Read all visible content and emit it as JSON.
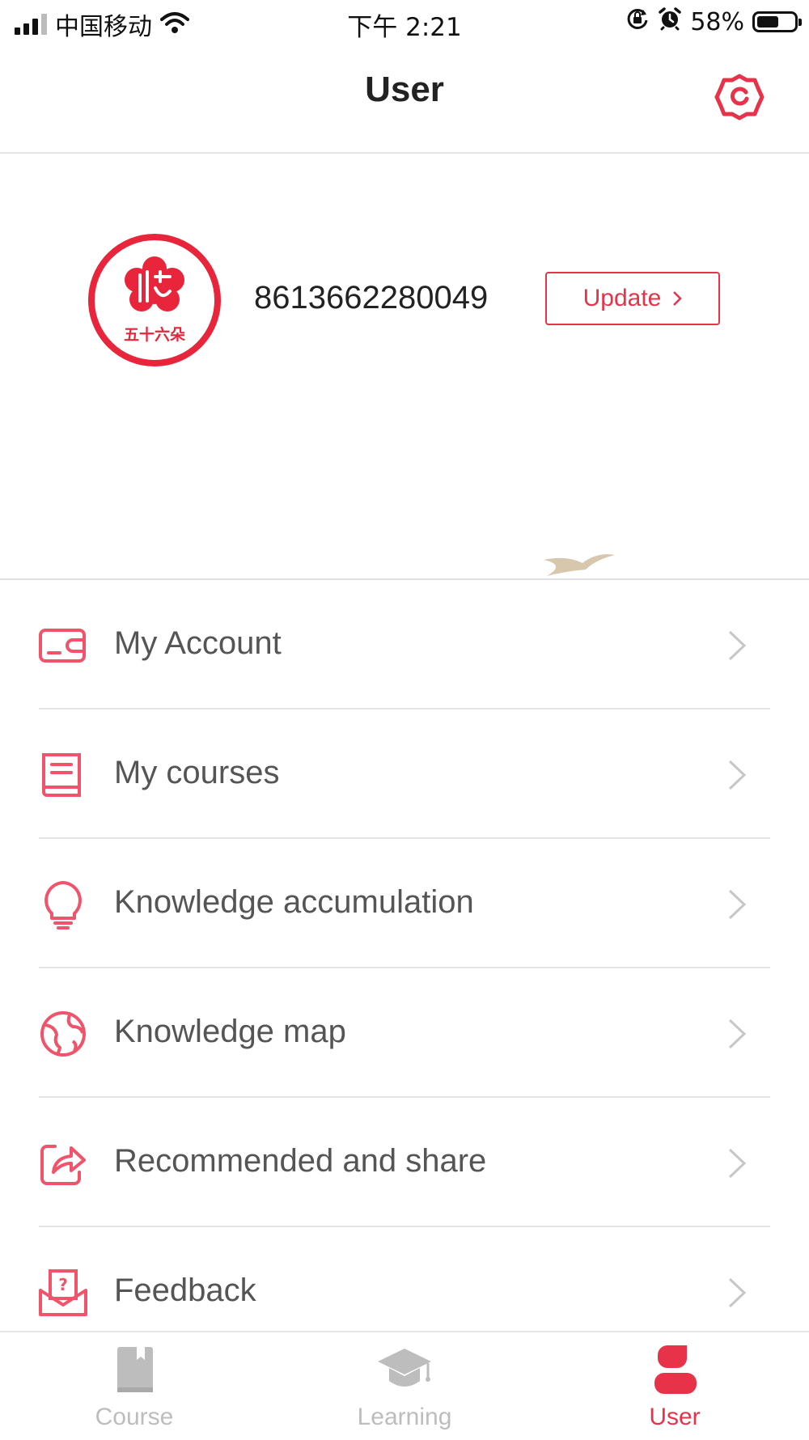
{
  "status_bar": {
    "carrier": "中国移动",
    "time": "下午 2:21",
    "battery_text": "58%",
    "battery_level": 0.58,
    "icons": [
      "signal-icon",
      "wifi-icon",
      "orientation-lock-icon",
      "alarm-icon",
      "battery-icon"
    ]
  },
  "header": {
    "title": "User",
    "settings_icon": "gear-icon"
  },
  "profile": {
    "logo_text": "五十六朵",
    "phone": "8613662280049",
    "update_label": "Update"
  },
  "menu": [
    {
      "label": "My Account",
      "icon": "wallet-icon"
    },
    {
      "label": "My courses",
      "icon": "book-icon"
    },
    {
      "label": "Knowledge accumulation",
      "icon": "lightbulb-icon"
    },
    {
      "label": "Knowledge map",
      "icon": "globe-icon"
    },
    {
      "label": "Recommended and share",
      "icon": "share-icon"
    },
    {
      "label": "Feedback",
      "icon": "feedback-icon"
    }
  ],
  "tabs": [
    {
      "label": "Course",
      "icon": "book-icon",
      "active": false
    },
    {
      "label": "Learning",
      "icon": "graduation-cap-icon",
      "active": false
    },
    {
      "label": "User",
      "icon": "user-icon",
      "active": true
    }
  ],
  "colors": {
    "accent": "#e8324a",
    "inactive_tab": "#bdbdbd",
    "menu_text": "#555555",
    "divider": "#e4e4e4"
  }
}
